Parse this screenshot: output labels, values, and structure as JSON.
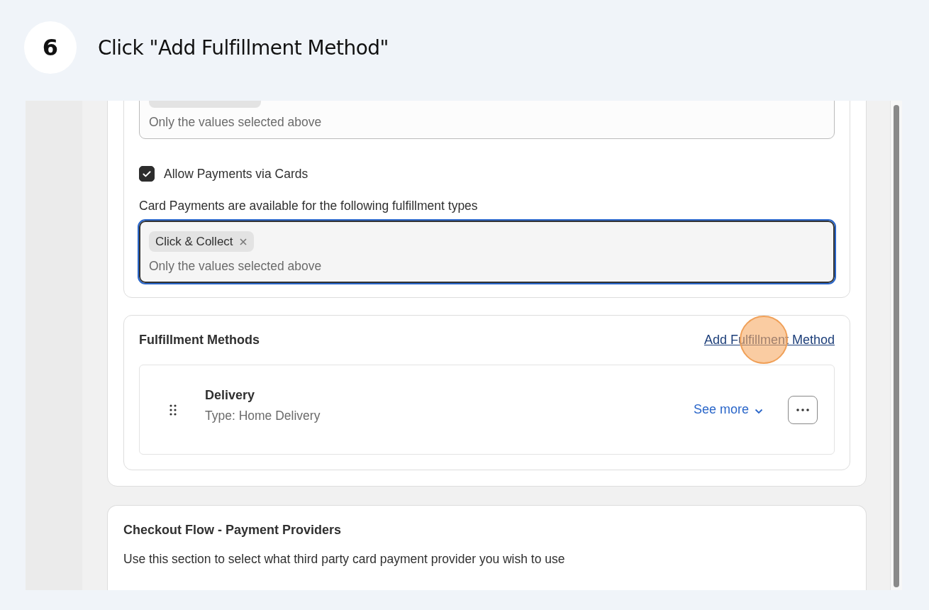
{
  "step": {
    "number": "6",
    "instruction": "Click \"Add Fulfillment Method\""
  },
  "first_field": {
    "placeholder": "Only the values selected above"
  },
  "allow_cards": {
    "label": "Allow Payments via Cards",
    "checked": true
  },
  "card_types": {
    "label": "Card Payments are available for the following fulfillment types",
    "tags": [
      "Click & Collect"
    ],
    "placeholder": "Only the values selected above",
    "focused": true
  },
  "fulfillment": {
    "title": "Fulfillment Methods",
    "add_link": "Add Fulfillment Method",
    "methods": [
      {
        "name": "Delivery",
        "type": "Type: Home Delivery",
        "see_more": "See more"
      }
    ]
  },
  "payment_providers": {
    "title": "Checkout Flow - Payment Providers",
    "description": "Use this section to select what third party card payment provider you wish to use"
  }
}
